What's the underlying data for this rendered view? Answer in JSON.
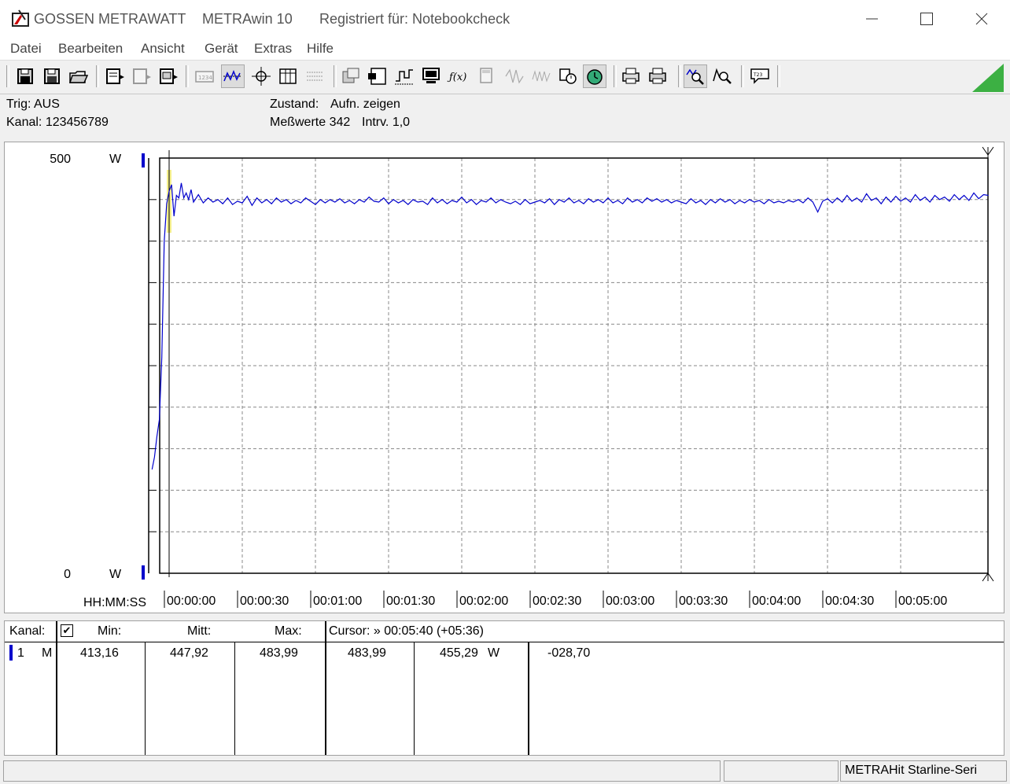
{
  "title": {
    "brand": "GOSSEN METRAWATT",
    "app": "METRAwin 10",
    "registered": "Registriert für: Notebookcheck"
  },
  "menu": [
    "Datei",
    "Bearbeiten",
    "Ansicht",
    "Gerät",
    "Extras",
    "Hilfe"
  ],
  "info": {
    "trig": "Trig: AUS",
    "kanal": "Kanal: 123456789",
    "zustand_label": "Zustand:",
    "zustand_value": "Aufn. zeigen",
    "messwerte": "Meßwerte 342",
    "intrv": "Intrv. 1,0"
  },
  "chart_data": {
    "type": "line",
    "y_top_label": "500",
    "y_bottom_label": "0",
    "y_unit": "W",
    "ylim": [
      0,
      500
    ],
    "x_axis_label": "HH:MM:SS",
    "x_ticks": [
      "00:00:00",
      "00:00:30",
      "00:01:00",
      "00:01:30",
      "00:02:00",
      "00:02:30",
      "00:03:00",
      "00:03:30",
      "00:04:00",
      "00:04:30",
      "00:05:00"
    ],
    "grid": true,
    "series": [
      {
        "color": "#0000cc",
        "points": [
          [
            -7,
            125
          ],
          [
            -6,
            140
          ],
          [
            -5,
            165
          ],
          [
            -4,
            185
          ],
          [
            -3,
            260
          ],
          [
            -2,
            400
          ],
          [
            -1,
            445
          ],
          [
            0,
            460
          ],
          [
            1,
            468
          ],
          [
            2,
            430
          ],
          [
            3,
            455
          ],
          [
            4,
            452
          ],
          [
            5,
            470
          ],
          [
            6,
            452
          ],
          [
            7,
            458
          ],
          [
            8,
            450
          ],
          [
            9,
            462
          ],
          [
            10,
            447
          ],
          [
            12,
            456
          ],
          [
            14,
            446
          ],
          [
            16,
            452
          ],
          [
            18,
            447
          ],
          [
            20,
            450
          ],
          [
            22,
            445
          ],
          [
            24,
            452
          ],
          [
            26,
            444
          ],
          [
            28,
            448
          ],
          [
            30,
            446
          ],
          [
            32,
            454
          ],
          [
            34,
            443
          ],
          [
            36,
            452
          ],
          [
            38,
            446
          ],
          [
            40,
            450
          ],
          [
            42,
            445
          ],
          [
            44,
            452
          ],
          [
            46,
            447
          ],
          [
            48,
            450
          ],
          [
            50,
            445
          ],
          [
            52,
            449
          ],
          [
            54,
            446
          ],
          [
            56,
            452
          ],
          [
            58,
            448
          ],
          [
            60,
            444
          ],
          [
            62,
            450
          ],
          [
            64,
            446
          ],
          [
            66,
            450
          ],
          [
            68,
            447
          ],
          [
            70,
            451
          ],
          [
            72,
            446
          ],
          [
            74,
            449
          ],
          [
            76,
            445
          ],
          [
            78,
            450
          ],
          [
            80,
            447
          ],
          [
            82,
            453
          ],
          [
            84,
            448
          ],
          [
            86,
            447
          ],
          [
            88,
            452
          ],
          [
            90,
            445
          ],
          [
            92,
            450
          ],
          [
            94,
            446
          ],
          [
            96,
            449
          ],
          [
            98,
            444
          ],
          [
            100,
            450
          ],
          [
            102,
            447
          ],
          [
            104,
            448
          ],
          [
            106,
            444
          ],
          [
            108,
            452
          ],
          [
            110,
            446
          ],
          [
            112,
            450
          ],
          [
            114,
            445
          ],
          [
            116,
            449
          ],
          [
            118,
            447
          ],
          [
            120,
            453
          ],
          [
            122,
            446
          ],
          [
            124,
            450
          ],
          [
            126,
            444
          ],
          [
            128,
            449
          ],
          [
            130,
            447
          ],
          [
            132,
            452
          ],
          [
            134,
            446
          ],
          [
            136,
            450
          ],
          [
            138,
            447
          ],
          [
            140,
            445
          ],
          [
            142,
            448
          ],
          [
            144,
            444
          ],
          [
            146,
            450
          ],
          [
            148,
            445
          ],
          [
            150,
            447
          ],
          [
            152,
            449
          ],
          [
            154,
            446
          ],
          [
            156,
            451
          ],
          [
            158,
            444
          ],
          [
            160,
            450
          ],
          [
            162,
            447
          ],
          [
            164,
            452
          ],
          [
            166,
            446
          ],
          [
            168,
            449
          ],
          [
            170,
            445
          ],
          [
            172,
            451
          ],
          [
            174,
            447
          ],
          [
            176,
            450
          ],
          [
            178,
            446
          ],
          [
            180,
            452
          ],
          [
            182,
            446
          ],
          [
            184,
            449
          ],
          [
            186,
            445
          ],
          [
            188,
            452
          ],
          [
            190,
            447
          ],
          [
            192,
            450
          ],
          [
            194,
            446
          ],
          [
            196,
            452
          ],
          [
            198,
            448
          ],
          [
            200,
            451
          ],
          [
            202,
            447
          ],
          [
            204,
            450
          ],
          [
            206,
            446
          ],
          [
            208,
            449
          ],
          [
            210,
            447
          ],
          [
            212,
            445
          ],
          [
            214,
            451
          ],
          [
            216,
            446
          ],
          [
            218,
            449
          ],
          [
            220,
            444
          ],
          [
            222,
            450
          ],
          [
            224,
            446
          ],
          [
            226,
            451
          ],
          [
            228,
            447
          ],
          [
            230,
            450
          ],
          [
            232,
            445
          ],
          [
            234,
            449
          ],
          [
            236,
            446
          ],
          [
            238,
            450
          ],
          [
            240,
            447
          ],
          [
            242,
            449
          ],
          [
            244,
            445
          ],
          [
            246,
            450
          ],
          [
            248,
            446
          ],
          [
            250,
            448
          ],
          [
            252,
            446
          ],
          [
            254,
            449
          ],
          [
            256,
            447
          ],
          [
            258,
            450
          ],
          [
            260,
            446
          ],
          [
            262,
            452
          ],
          [
            264,
            447
          ],
          [
            266,
            435
          ],
          [
            268,
            448
          ],
          [
            270,
            451
          ],
          [
            272,
            446
          ],
          [
            274,
            452
          ],
          [
            276,
            447
          ],
          [
            278,
            455
          ],
          [
            280,
            448
          ],
          [
            282,
            452
          ],
          [
            284,
            447
          ],
          [
            286,
            457
          ],
          [
            288,
            449
          ],
          [
            290,
            452
          ],
          [
            292,
            445
          ],
          [
            294,
            453
          ],
          [
            296,
            447
          ],
          [
            298,
            454
          ],
          [
            300,
            448
          ],
          [
            302,
            452
          ],
          [
            304,
            447
          ],
          [
            306,
            456
          ],
          [
            308,
            449
          ],
          [
            310,
            453
          ],
          [
            312,
            447
          ],
          [
            314,
            455
          ],
          [
            316,
            450
          ],
          [
            318,
            453
          ],
          [
            320,
            448
          ],
          [
            322,
            456
          ],
          [
            324,
            450
          ],
          [
            326,
            455
          ],
          [
            328,
            449
          ],
          [
            330,
            458
          ],
          [
            332,
            451
          ],
          [
            334,
            456
          ],
          [
            336,
            455
          ]
        ]
      }
    ]
  },
  "table": {
    "headers": {
      "kanal": "Kanal:",
      "check": "✔",
      "min": "Min:",
      "mitt": "Mitt:",
      "max": "Max:",
      "cursor": "Cursor: » 00:05:40 (+05:36)"
    },
    "rows": [
      {
        "channel": "1",
        "mode": "M",
        "min": "413,16",
        "mitt": "447,92",
        "max": "483,99",
        "cursor_value": "483,99",
        "cursor_value2": "455,29",
        "unit": "W",
        "diff": "-028,70"
      }
    ]
  },
  "status": {
    "device": "METRAHit Starline-Seri"
  },
  "colors": {
    "series": "#0000cc",
    "marker": "#0000cc",
    "highlight": "#f5f08c",
    "grid": "#808080",
    "corner_triangle": "#3cb043"
  }
}
